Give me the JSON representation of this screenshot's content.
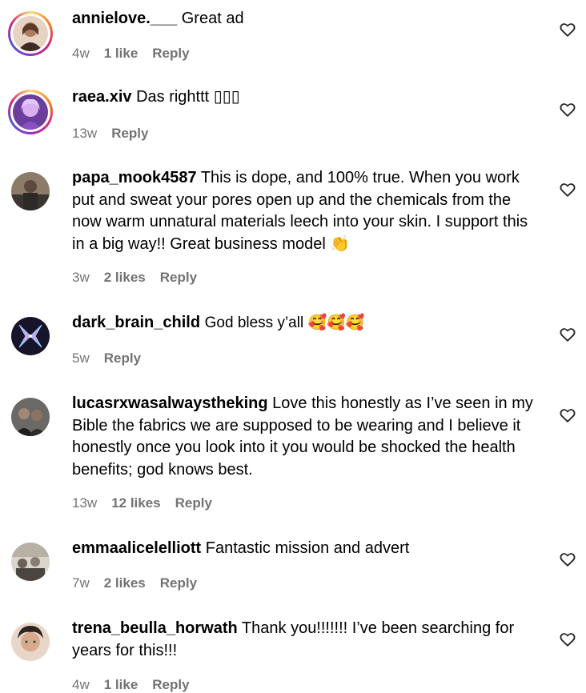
{
  "comments": [
    {
      "username": "annielove.___",
      "text": "Great ad",
      "time": "4w",
      "likes": "1 like",
      "reply": "Reply",
      "heart_icon": "heart-outline-icon",
      "avatar_colors": [
        "#c79d7d",
        "#3d2a22"
      ]
    },
    {
      "username": "raea.xiv",
      "text": "Das righttt ▯▯▯",
      "time": "13w",
      "likes": "",
      "reply": "Reply",
      "heart_icon": "heart-outline-icon",
      "avatar_colors": [
        "#b07ad8",
        "#4b2a6d"
      ]
    },
    {
      "username": "papa_mook4587",
      "text": "This is dope, and 100% true. When you work put and sweat your pores open up and the chemicals from the now warm unnatural materials leech into your skin. I support this in a big way!! Great business model 👏",
      "time": "3w",
      "likes": "2 likes",
      "reply": "Reply",
      "heart_icon": "heart-outline-icon",
      "avatar_colors": [
        "#7a6a5d",
        "#2c2a26"
      ]
    },
    {
      "username": "dark_brain_child",
      "text": "God bless y’all 🥰🥰🥰",
      "time": "5w",
      "likes": "",
      "reply": "Reply",
      "heart_icon": "heart-outline-icon",
      "avatar_colors": [
        "#1a1630",
        "#d8a0e0"
      ]
    },
    {
      "username": "lucasrxwasalwaystheking",
      "text": "Love this honestly as I’ve seen in my Bible the fabrics we are supposed to be wearing and I believe it honestly once you look into it you would be shocked the health benefits; god knows best.",
      "time": "13w",
      "likes": "12 likes",
      "reply": "Reply",
      "heart_icon": "heart-outline-icon",
      "avatar_colors": [
        "#5d5c5a",
        "#1f1e1d"
      ]
    },
    {
      "username": "emmaalicelelliott",
      "text": "Fantastic mission and advert",
      "time": "7w",
      "likes": "2 likes",
      "reply": "Reply",
      "heart_icon": "heart-outline-icon",
      "avatar_colors": [
        "#c9c3b8",
        "#6c6157"
      ]
    },
    {
      "username": "trena_beulla_horwath",
      "text": "Thank you!!!!!!! I’ve been searching for years for this!!!",
      "time": "4w",
      "likes": "1 like",
      "reply": "Reply",
      "heart_icon": "heart-outline-icon",
      "avatar_colors": [
        "#c89a80",
        "#2d2420"
      ]
    }
  ]
}
